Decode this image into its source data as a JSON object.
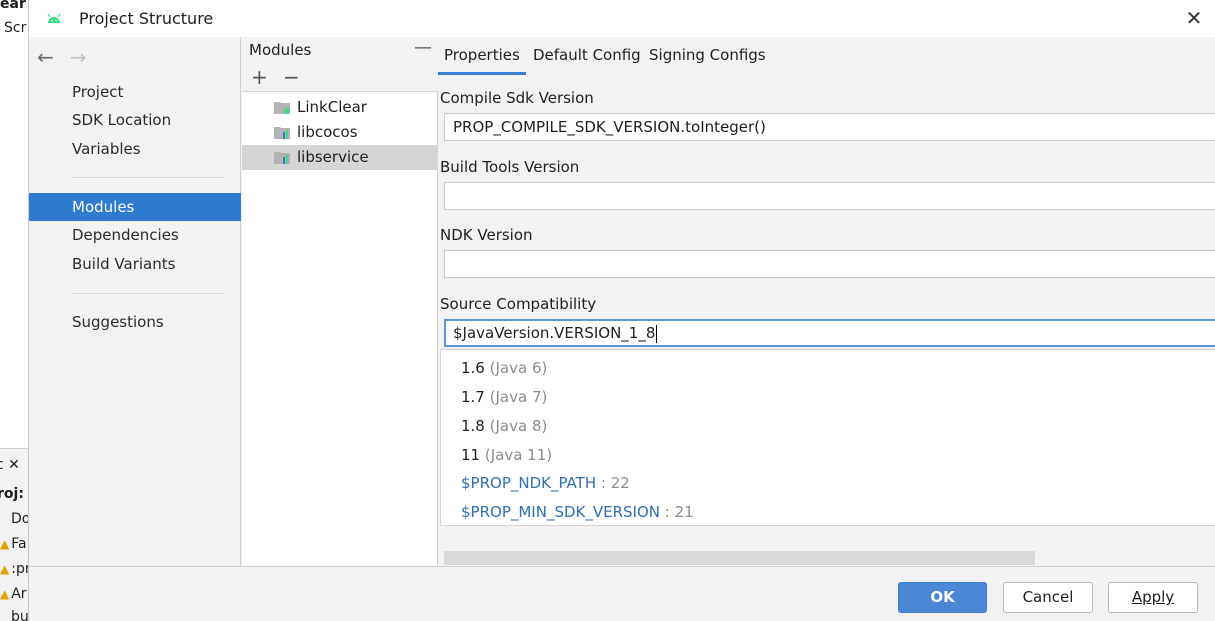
{
  "background": {
    "lines": [
      "ear",
      "Scr",
      "c ✕",
      "roj:",
      "Do",
      "Fa",
      ":pr",
      "Ar",
      "bu"
    ]
  },
  "dialog": {
    "title": "Project Structure",
    "close_label": "✕"
  },
  "nav": {
    "back_icon": "←",
    "forward_icon": "→",
    "group1": [
      "Project",
      "SDK Location",
      "Variables"
    ],
    "group2": [
      "Modules",
      "Dependencies",
      "Build Variants"
    ],
    "group3": [
      "Suggestions"
    ],
    "selected": "Modules"
  },
  "modules": {
    "header": "Modules",
    "collapse_icon": "—",
    "add_icon": "+",
    "remove_icon": "−",
    "items": [
      "LinkClear",
      "libcocos",
      "libservice"
    ],
    "selected": "libservice"
  },
  "tabs": [
    "Properties",
    "Default Config",
    "Signing Configs"
  ],
  "active_tab": "Properties",
  "fields": {
    "compile_sdk": {
      "label": "Compile Sdk Version",
      "value": "PROP_COMPILE_SDK_VERSION.toInteger()"
    },
    "build_tools": {
      "label": "Build Tools Version",
      "value": ""
    },
    "ndk": {
      "label": "NDK Version",
      "value": ""
    },
    "source_compat": {
      "label": "Source Compatibility",
      "value": "$JavaVersion.VERSION_1_8"
    }
  },
  "dropdown_options": [
    {
      "value": "1.6",
      "hint": "(Java 6)"
    },
    {
      "value": "1.7",
      "hint": "(Java 7)"
    },
    {
      "value": "1.8",
      "hint": "(Java 8)"
    },
    {
      "value": "11",
      "hint": "(Java 11)"
    },
    {
      "value": "$PROP_NDK_PATH",
      "hint": ": 22"
    },
    {
      "value": "$PROP_MIN_SDK_VERSION",
      "hint": ": 21"
    }
  ],
  "buttons": {
    "ok": "OK",
    "cancel": "Cancel",
    "apply": "Apply"
  },
  "colors": {
    "accent": "#2f7bd0",
    "primary_button": "#4a88d6",
    "variable_text": "#2f6fb5"
  }
}
